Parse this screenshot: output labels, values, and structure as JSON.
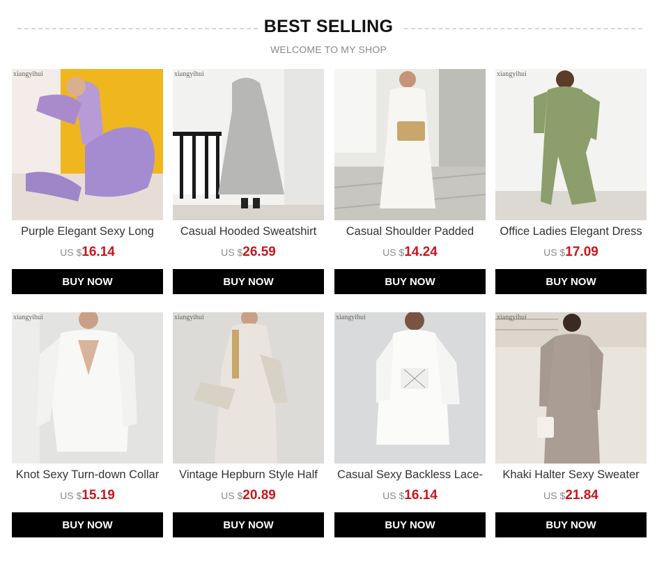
{
  "header": {
    "title": "BEST SELLING",
    "subtitle": "WELCOME TO MY SHOP"
  },
  "products": [
    {
      "name": "Purple Elegant Sexy Long",
      "currency": "US $",
      "price": "16.14",
      "button": "BUY NOW",
      "watermark": "xiangyihui"
    },
    {
      "name": "Casual Hooded Sweatshirt",
      "currency": "US $",
      "price": "26.59",
      "button": "BUY NOW",
      "watermark": "xiangyihui"
    },
    {
      "name": "Casual Shoulder Padded",
      "currency": "US $",
      "price": "14.24",
      "button": "BUY NOW",
      "watermark": ""
    },
    {
      "name": "Office Ladies Elegant Dress",
      "currency": "US $",
      "price": "17.09",
      "button": "BUY NOW",
      "watermark": "xiangyihui"
    },
    {
      "name": "Knot Sexy Turn-down Collar",
      "currency": "US $",
      "price": "15.19",
      "button": "BUY NOW",
      "watermark": "xiangyihui"
    },
    {
      "name": "Vintage Hepburn Style Half",
      "currency": "US $",
      "price": "20.89",
      "button": "BUY NOW",
      "watermark": "xiangyihui"
    },
    {
      "name": "Casual Sexy Backless Lace-",
      "currency": "US $",
      "price": "16.14",
      "button": "BUY NOW",
      "watermark": "xiangyihui"
    },
    {
      "name": "Khaki Halter Sexy Sweater",
      "currency": "US $",
      "price": "21.84",
      "button": "BUY NOW",
      "watermark": "xiangyihui"
    }
  ],
  "colors": {
    "price": "#c8161d",
    "button_bg": "#000000",
    "button_text": "#ffffff"
  }
}
